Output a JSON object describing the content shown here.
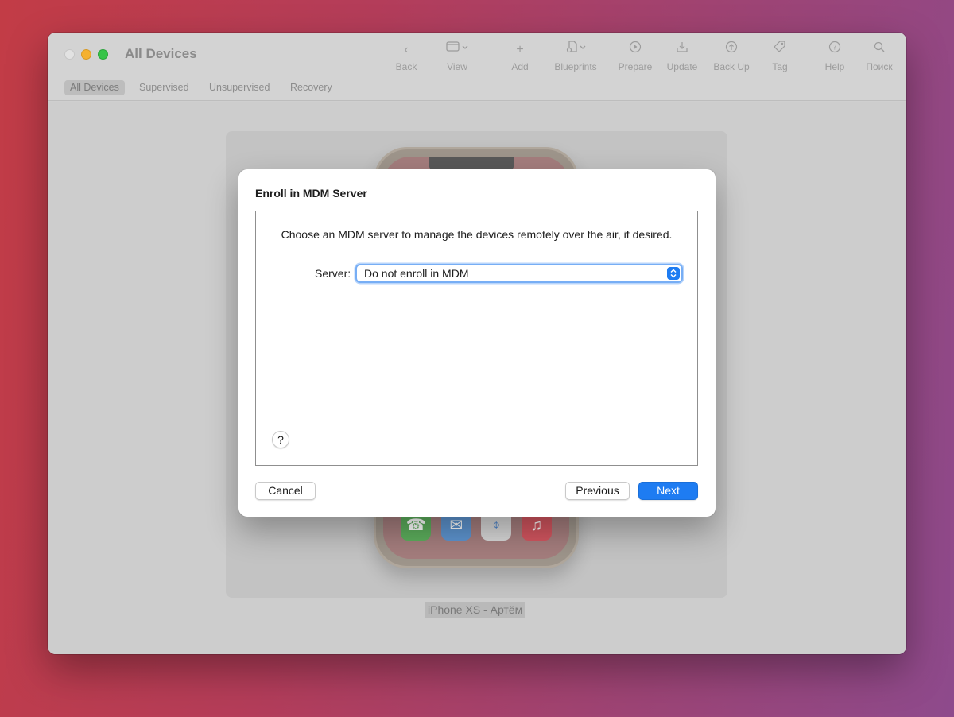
{
  "window": {
    "title": "All Devices"
  },
  "toolbar": {
    "items": [
      {
        "label": "Back",
        "icon": "chevron-left-icon"
      },
      {
        "label": "View",
        "icon": "window-icon"
      },
      {
        "label": "Add",
        "icon": "plus-icon"
      },
      {
        "label": "Blueprints",
        "icon": "blueprints-icon"
      },
      {
        "label": "Prepare",
        "icon": "prepare-icon"
      },
      {
        "label": "Update",
        "icon": "download-icon"
      },
      {
        "label": "Back Up",
        "icon": "upload-icon"
      },
      {
        "label": "Tag",
        "icon": "tag-icon"
      },
      {
        "label": "Help",
        "icon": "help-icon"
      },
      {
        "label": "Поиск",
        "icon": "search-icon"
      }
    ]
  },
  "tabs": [
    {
      "label": "All Devices",
      "active": true
    },
    {
      "label": "Supervised",
      "active": false
    },
    {
      "label": "Unsupervised",
      "active": false
    },
    {
      "label": "Recovery",
      "active": false
    }
  ],
  "device": {
    "label": "iPhone XS - Артём",
    "dock_apps": [
      "phone-icon",
      "mail-icon",
      "safari-icon",
      "music-icon"
    ]
  },
  "dialog": {
    "title": "Enroll in MDM Server",
    "description": "Choose an MDM server to manage the devices remotely over the air, if desired.",
    "server_label": "Server:",
    "server_value": "Do not enroll in MDM",
    "help": "?",
    "cancel_label": "Cancel",
    "previous_label": "Previous",
    "next_label": "Next"
  },
  "colors": {
    "accent": "#1e7cf2",
    "traffic_red": "#e2e2e2",
    "traffic_yellow": "#f5b12f",
    "traffic_green": "#36c448"
  }
}
